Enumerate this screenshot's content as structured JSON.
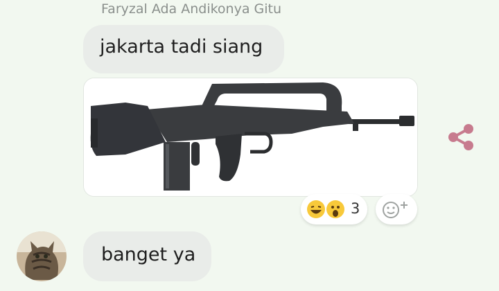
{
  "chat": {
    "sender_name": "Faryzal Ada Andikonya Gitu",
    "messages": [
      {
        "text": "jakarta tadi siang"
      },
      {
        "text": "banget ya"
      }
    ],
    "image_attachment": {
      "description_icon": "rifle-photo"
    },
    "reactions": {
      "emojis": [
        "laughing-emoji",
        "wow-emoji"
      ],
      "count": "3"
    },
    "share_icon": "share-icon",
    "add_reaction_icon": "add-reaction-icon"
  },
  "colors": {
    "background": "#f2f8f0",
    "bubble": "#e9ece9",
    "share": "#c77b8e",
    "sender_name": "#8a8f8c"
  }
}
